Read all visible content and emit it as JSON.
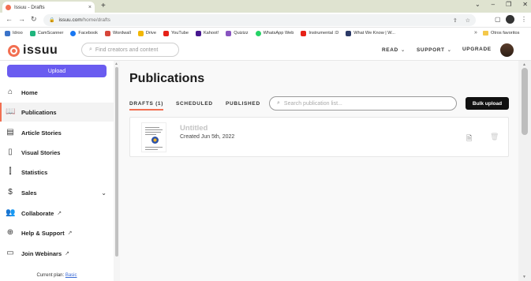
{
  "browser": {
    "tab_title": "Issuu - Drafts",
    "tab_close": "×",
    "new_tab": "+",
    "window_controls": [
      "⌄",
      "–",
      "❐",
      "✕"
    ],
    "back": "←",
    "forward": "→",
    "reload": "↻",
    "url_host": "issuu.com",
    "url_path": "/home/drafts",
    "bookmarks": [
      {
        "label": "Idroo",
        "color": "#3a73c9"
      },
      {
        "label": "CamScanner",
        "color": "#1fb57d"
      },
      {
        "label": "Facebook",
        "color": "#1877f2"
      },
      {
        "label": "Wordwall",
        "color": "#d7463a"
      },
      {
        "label": "Drive",
        "color": "#f2b705"
      },
      {
        "label": "YouTube",
        "color": "#e62117"
      },
      {
        "label": "Kahoot!",
        "color": "#46178f"
      },
      {
        "label": "Quizizz",
        "color": "#8854c0"
      },
      {
        "label": "WhatsApp Web",
        "color": "#25d366"
      },
      {
        "label": "Instrumental :D",
        "color": "#e62117"
      },
      {
        "label": "What We Know | W...",
        "color": "#2b3a67"
      }
    ],
    "bookmarks_more": "»",
    "other_bookmarks": "Otros favoritos"
  },
  "header": {
    "logo_text": "issuu",
    "search_placeholder": "Find creators and content",
    "nav": [
      {
        "label": "READ",
        "chevron": "⌄"
      },
      {
        "label": "SUPPORT",
        "chevron": "⌄"
      },
      {
        "label": "UPGRADE",
        "chevron": ""
      }
    ]
  },
  "sidebar": {
    "upload_label": "Upload",
    "items": [
      {
        "label": "Home",
        "icon": "⌂",
        "ext": ""
      },
      {
        "label": "Publications",
        "icon": "📖",
        "ext": ""
      },
      {
        "label": "Article Stories",
        "icon": "▤",
        "ext": ""
      },
      {
        "label": "Visual Stories",
        "icon": "▯",
        "ext": ""
      },
      {
        "label": "Statistics",
        "icon": "⫿",
        "ext": ""
      },
      {
        "label": "Sales",
        "icon": "$",
        "ext": ""
      },
      {
        "label": "Collaborate",
        "icon": "👥",
        "ext": "↗"
      },
      {
        "label": "Help & Support",
        "icon": "⊕",
        "ext": "↗"
      },
      {
        "label": "Join Webinars",
        "icon": "▭",
        "ext": "↗"
      }
    ],
    "sales_caret": "⌄",
    "plan_prefix": "Current plan: ",
    "plan_name": "Basic"
  },
  "main": {
    "title": "Publications",
    "tabs": [
      "DRAFTS (1)",
      "SCHEDULED",
      "PUBLISHED"
    ],
    "search_placeholder": "Search publication list...",
    "bulk_upload": "Bulk upload",
    "publication": {
      "title": "Untitled",
      "created": "Created Jun 5th, 2022"
    }
  },
  "colors": {
    "accent": "#f26f51",
    "upload_button": "#6a5cf0",
    "bulk_button": "#111111"
  }
}
